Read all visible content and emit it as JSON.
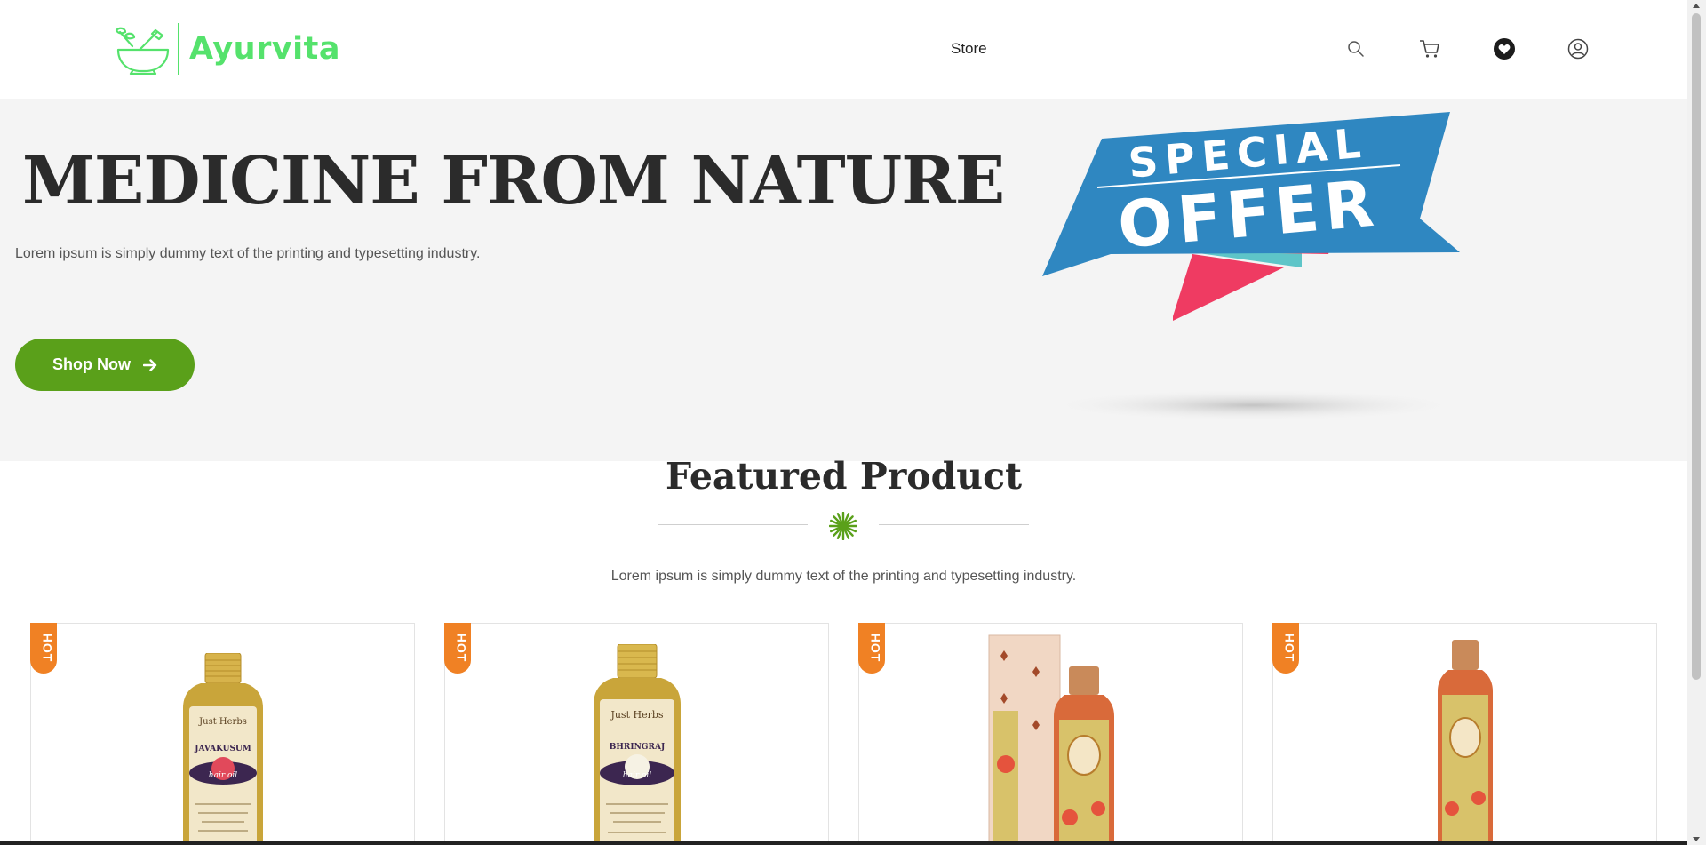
{
  "brand": {
    "name": "Ayurvita",
    "color": "#55e26c"
  },
  "nav": {
    "store_label": "Store"
  },
  "header_icons": [
    "search-icon",
    "cart-icon",
    "heart-icon",
    "user-icon"
  ],
  "hero": {
    "title": "MEDICINE FROM NATURE",
    "subtitle": "Lorem ipsum is simply dummy text of the printing and typesetting industry.",
    "cta_label": "Shop Now",
    "banner": {
      "line1": "SPECIAL",
      "line2": "OFFER"
    }
  },
  "featured": {
    "title": "Featured Product",
    "subtitle": "Lorem ipsum is simply dummy text of the printing and typesetting industry.",
    "products": [
      {
        "badge": "HOT",
        "brand": "Just Herbs",
        "name": "JAVAKUSUM",
        "type": "hair oil"
      },
      {
        "badge": "HOT",
        "brand": "Just Herbs",
        "name": "BHRINGRAJ",
        "type": "hair oil"
      },
      {
        "badge": "HOT"
      },
      {
        "badge": "HOT"
      }
    ]
  },
  "colors": {
    "accent_green": "#5aa01a",
    "hot_badge": "#f08124",
    "offer_blue": "#2f87c1",
    "offer_pink": "#ef3b62",
    "offer_teal": "#5ec5c8"
  }
}
